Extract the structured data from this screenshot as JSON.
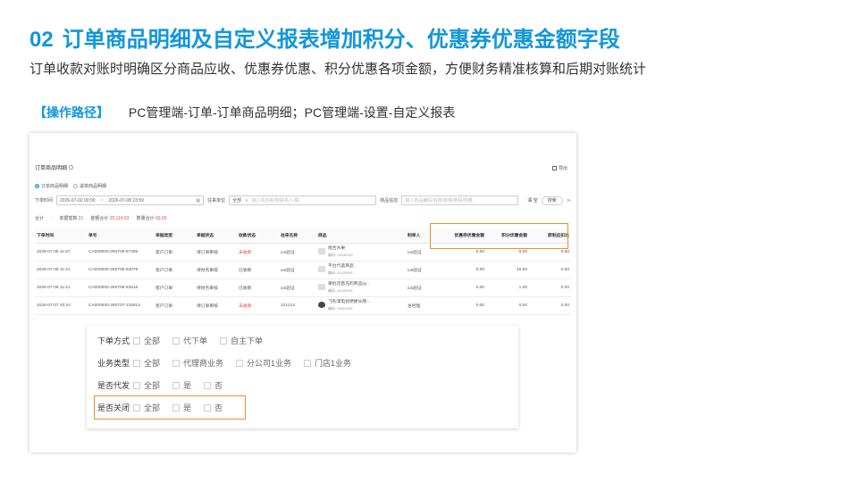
{
  "title": {
    "number": "02",
    "text": "订单商品明细及自定义报表增加积分、优惠券优惠金额字段"
  },
  "subtitle": "订单收款对账时明确区分商品应收、优惠券优惠、积分优惠各项金额，方便财务精准核算和后期对账统计",
  "path": {
    "label": "【操作路径】",
    "text": "PC管理端-订单-订单商品明细；PC管理端-设置-自定义报表"
  },
  "app": {
    "page_title": "订单商品明细",
    "export_label": "导出",
    "radios": [
      "订单商品明细",
      "退单商品明细"
    ],
    "filters": {
      "time_label": "下单时间",
      "start": "2026-07-02 00:00",
      "sep": "~",
      "end": "2026-07-08 23:59",
      "unit_label": "往来单位",
      "unit_value": "全部",
      "unit_placeholder": "输入机构名称/联系人/联...",
      "goods_label": "商品信息",
      "goods_placeholder": "输入商品编码/名称/规格/条码/规格",
      "clear": "清 空",
      "search": "搜索"
    },
    "totals": {
      "label": "合计",
      "orders_label": "单据笔数",
      "orders_value": "21",
      "amount_label": "金额合计",
      "amount_value": "25,114.53",
      "qty_label": "数量合计",
      "qty_value": "69.00"
    },
    "columns": [
      "下单时间",
      "单号",
      "单据类型",
      "单据状态",
      "收款状态",
      "往来名称",
      "商品",
      "制单人",
      "优惠券优惠金额",
      "积分优惠金额",
      "原制应扣比"
    ],
    "rows": [
      {
        "time": "2026-07-08 11:57",
        "no": "CA000000-260708-67495",
        "type": "客户订单",
        "status": "待订单审核",
        "pay": "未收款",
        "pay_red": true,
        "party": "ios验证",
        "goods": "组合水果",
        "code": "编码: 33035302",
        "maker": "ios验证",
        "coupon": "0.00",
        "points": "0.00",
        "last": "0.00"
      },
      {
        "time": "2026-07-08 11:21",
        "no": "CA000000-260708-63079",
        "type": "客户订单",
        "status": "待财务审核",
        "pay": "已收款",
        "pay_red": false,
        "party": "ios验证",
        "goods": "平台代选商品",
        "code": "编码: 61025901",
        "maker": "ios验证",
        "coupon": "0.00",
        "points": "15.00",
        "last": "0.00"
      },
      {
        "time": "2026-07-08 11:21",
        "no": "CA000000-260708-63516",
        "type": "客户订单",
        "status": "待财务审核",
        "pay": "已收款",
        "pay_red": false,
        "party": "ios验证",
        "goods": "审批流直充的商品(iy...",
        "code": "编码: 61025901",
        "maker": "ios验证",
        "coupon": "0.00",
        "points": "1.00",
        "last": "0.00"
      },
      {
        "time": "2026-07-07 20:24",
        "no": "CA000000-260707-125913",
        "type": "客户订单",
        "status": "待订单审核",
        "pay": "未收款",
        "pay_red": true,
        "party": "121212",
        "goods": "飞利浦电视便捷长频...",
        "code": "编码: 03001801",
        "maker": "总经理",
        "coupon": "0.00",
        "points": "0.00",
        "last": "0.00"
      }
    ]
  },
  "panel": {
    "rows": [
      {
        "label": "下单方式",
        "options": [
          "全部",
          "代下单",
          "自主下单"
        ]
      },
      {
        "label": "业务类型",
        "options": [
          "全部",
          "代理商业务",
          "分公司1业务",
          "门店1业务"
        ]
      },
      {
        "label": "是否代发",
        "options": [
          "全部",
          "是",
          "否"
        ]
      },
      {
        "label": "是否关闭",
        "options": [
          "全部",
          "是",
          "否"
        ]
      }
    ]
  },
  "colors": {
    "accent": "#1296db",
    "highlight": "#f08c2e",
    "warn": "#e84b3c"
  }
}
